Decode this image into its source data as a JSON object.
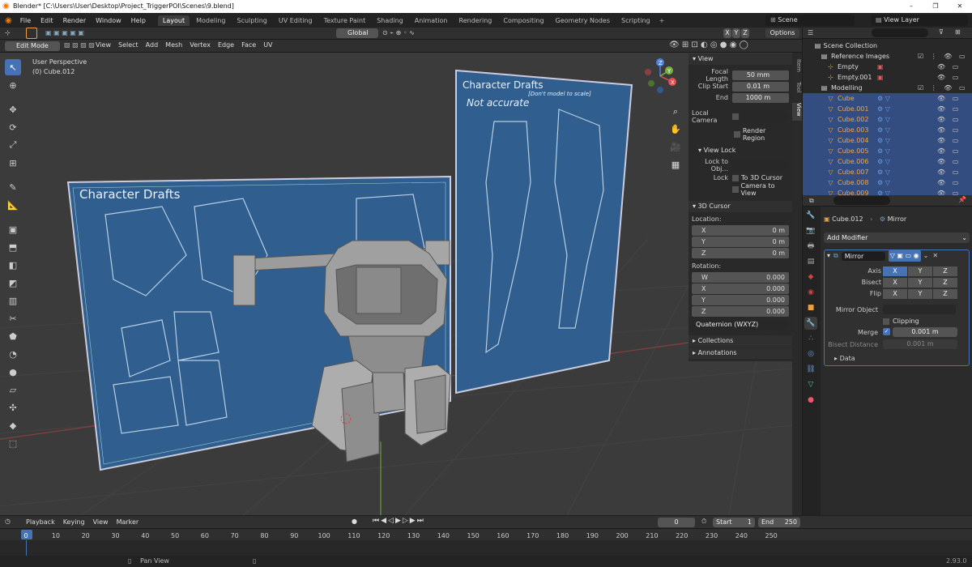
{
  "window": {
    "title": "Blender* [C:\\Users\\User\\Desktop\\Project_TriggerPOI\\Scenes\\9.blend]",
    "buttons": [
      "–",
      "❐",
      "✕"
    ]
  },
  "menu": {
    "items": [
      "File",
      "Edit",
      "Render",
      "Window",
      "Help"
    ]
  },
  "workspaces": [
    "Layout",
    "Modeling",
    "Sculpting",
    "UV Editing",
    "Texture Paint",
    "Shading",
    "Animation",
    "Rendering",
    "Compositing",
    "Geometry Nodes",
    "Scripting"
  ],
  "workspace_active": "Layout",
  "scene": {
    "name": "Scene",
    "view_layer": "View Layer"
  },
  "toolheader": {
    "transform": "Global",
    "options": "Options",
    "axes": [
      "X",
      "Y",
      "Z"
    ]
  },
  "viewport_header": {
    "mode": "Edit Mode",
    "menus": [
      "View",
      "Select",
      "Add",
      "Mesh",
      "Vertex",
      "Edge",
      "Face",
      "UV"
    ]
  },
  "viewport": {
    "perspective": "User Perspective",
    "object": "(0) Cube.012",
    "blueprint_title": "Character Drafts",
    "note": "Not accurate",
    "note_small": "[Don't model to scale]"
  },
  "npanel": {
    "tabs": [
      "Item",
      "Tool",
      "View"
    ],
    "view_header": "View",
    "focal_length_label": "Focal Length",
    "focal_length": "50 mm",
    "clip_start_label": "Clip Start",
    "clip_start": "0.01 m",
    "end_label": "End",
    "end": "1000 m",
    "local_camera": "Local Camera",
    "render_region": "Render Region",
    "view_lock_header": "View Lock",
    "lock_to_obj": "Lock to Obj...",
    "lock_label": "Lock",
    "to_3d_cursor": "To 3D Cursor",
    "camera_to_view": "Camera to View",
    "cursor_header": "3D Cursor",
    "location_label": "Location:",
    "location": [
      {
        "axis": "X",
        "val": "0 m"
      },
      {
        "axis": "Y",
        "val": "0 m"
      },
      {
        "axis": "Z",
        "val": "0 m"
      }
    ],
    "rotation_label": "Rotation:",
    "rotation": [
      {
        "axis": "W",
        "val": "0.000"
      },
      {
        "axis": "X",
        "val": "0.000"
      },
      {
        "axis": "Y",
        "val": "0.000"
      },
      {
        "axis": "Z",
        "val": "0.000"
      }
    ],
    "rotation_mode": "Quaternion (WXYZ)",
    "collections": "Collections",
    "annotations": "Annotations"
  },
  "outliner": {
    "root": "Scene Collection",
    "rows": [
      {
        "name": "Reference Images",
        "indent": 1,
        "type": "collection",
        "sel": false
      },
      {
        "name": "Empty",
        "indent": 2,
        "type": "empty",
        "sel": false
      },
      {
        "name": "Empty.001",
        "indent": 2,
        "type": "empty",
        "sel": false
      },
      {
        "name": "Modelling",
        "indent": 1,
        "type": "collection",
        "sel": false
      },
      {
        "name": "Cube",
        "indent": 2,
        "type": "mesh",
        "sel": true
      },
      {
        "name": "Cube.001",
        "indent": 2,
        "type": "mesh",
        "sel": true
      },
      {
        "name": "Cube.002",
        "indent": 2,
        "type": "mesh",
        "sel": true
      },
      {
        "name": "Cube.003",
        "indent": 2,
        "type": "mesh",
        "sel": true
      },
      {
        "name": "Cube.004",
        "indent": 2,
        "type": "mesh",
        "sel": true
      },
      {
        "name": "Cube.005",
        "indent": 2,
        "type": "mesh",
        "sel": true
      },
      {
        "name": "Cube.006",
        "indent": 2,
        "type": "mesh",
        "sel": true
      },
      {
        "name": "Cube.007",
        "indent": 2,
        "type": "mesh",
        "sel": true
      },
      {
        "name": "Cube.008",
        "indent": 2,
        "type": "mesh",
        "sel": true
      },
      {
        "name": "Cube.009",
        "indent": 2,
        "type": "mesh",
        "sel": true
      }
    ]
  },
  "properties": {
    "object": "Cube.012",
    "modifier_crumb": "Mirror",
    "add_modifier": "Add Modifier",
    "modifier_name": "Mirror",
    "axis_label": "Axis",
    "bisect_label": "Bisect",
    "flip_label": "Flip",
    "xyz": [
      "X",
      "Y",
      "Z"
    ],
    "mirror_object_label": "Mirror Object",
    "clipping": "Clipping",
    "merge_label": "Merge",
    "merge_val": "0.001 m",
    "bisect_distance_label": "Bisect Distance",
    "bisect_distance_val": "0.001 m",
    "data": "Data"
  },
  "timeline": {
    "menus": [
      "Playback",
      "Keying",
      "View",
      "Marker"
    ],
    "current": "0",
    "start_label": "Start",
    "start": "1",
    "end_label": "End",
    "end": "250",
    "ticks": [
      "0",
      "10",
      "20",
      "30",
      "40",
      "50",
      "60",
      "70",
      "80",
      "90",
      "100",
      "110",
      "120",
      "130",
      "140",
      "150",
      "160",
      "170",
      "180",
      "190",
      "200",
      "210",
      "220",
      "230",
      "240",
      "250"
    ]
  },
  "status": {
    "action": "Pan View",
    "version": "2.93.0"
  },
  "colors": {
    "accent": "#4772b3",
    "selected_text": "#f2a64b",
    "bg": "#3d3d3d"
  }
}
